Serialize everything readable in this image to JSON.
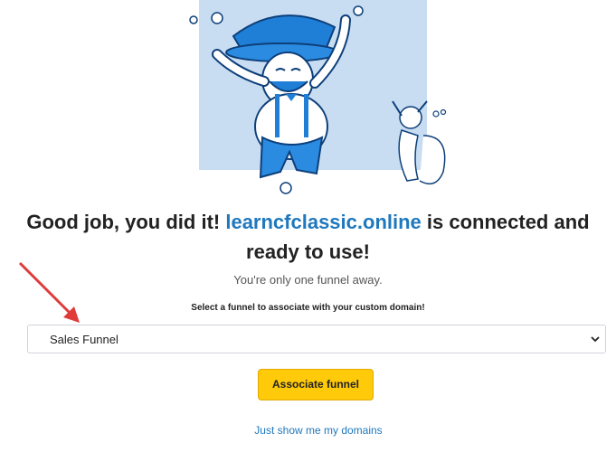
{
  "hero": {
    "illustration": "celebrating-cowboy-and-squirrel-illustration"
  },
  "headline": {
    "prefix": "Good job, you did it! ",
    "domain": "learncfclassic.online",
    "suffix": " is connected and ready to use!"
  },
  "subtitle": "You're only one funnel away.",
  "select": {
    "label": "Select a funnel to associate with your custom domain!",
    "value": "Sales Funnel"
  },
  "associate_button": "Associate funnel",
  "show_domains_link": "Just show me my domains",
  "colors": {
    "accent": "#1f78bd",
    "button": "#ffca0a",
    "hero_bg": "#c8ddf2",
    "arrow": "#e03a3a"
  }
}
